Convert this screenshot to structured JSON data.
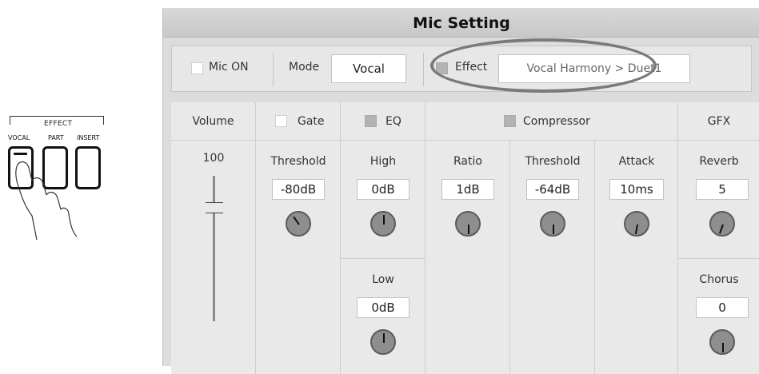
{
  "hardware": {
    "group_label": "EFFECT",
    "buttons": [
      {
        "label": "VOCAL"
      },
      {
        "label": "PART"
      },
      {
        "label": "INSERT"
      }
    ]
  },
  "panel": {
    "title": "Mic Setting",
    "mic_on": {
      "label": "Mic ON",
      "checked": false
    },
    "mode": {
      "label": "Mode",
      "value": "Vocal"
    },
    "effect": {
      "label": "Effect",
      "value": "Vocal Harmony > Duet1",
      "checked": true
    },
    "volume": {
      "header": "Volume",
      "value": "100",
      "level": 1.0
    },
    "gate": {
      "header": "Gate",
      "checked": false,
      "threshold_label": "Threshold",
      "threshold_value": "-80dB"
    },
    "eq": {
      "header": "EQ",
      "checked": true,
      "high_label": "High",
      "high_value": "0dB",
      "low_label": "Low",
      "low_value": "0dB"
    },
    "compressor": {
      "header": "Compressor",
      "checked": true,
      "ratio_label": "Ratio",
      "ratio_value": "1dB",
      "threshold_label": "Threshold",
      "threshold_value": "-64dB",
      "attack_label": "Attack",
      "attack_value": "10ms"
    },
    "gfx": {
      "header": "GFX",
      "reverb_label": "Reverb",
      "reverb_value": "5",
      "chorus_label": "Chorus",
      "chorus_value": "0"
    }
  },
  "colors": {
    "panel_bg": "#dcdcdc",
    "cell_bg": "#e9e9e9",
    "knob": "#8e8e8e",
    "highlight_ring": "#7a7a7a"
  }
}
